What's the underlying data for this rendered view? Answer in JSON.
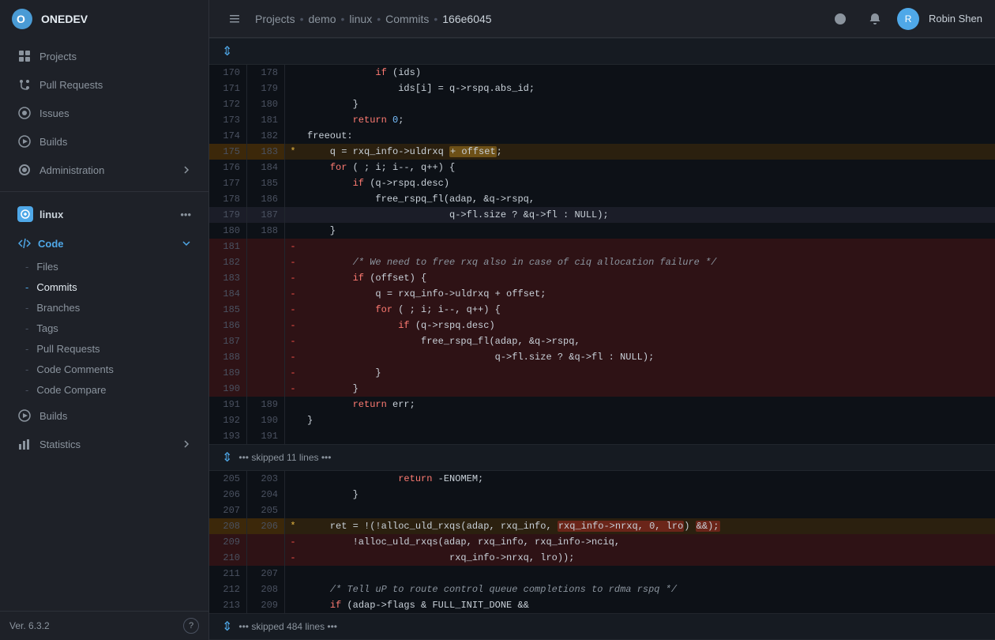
{
  "app": {
    "name": "ONEDEV",
    "version": "Ver. 6.3.2"
  },
  "topnav": {
    "breadcrumb": [
      "Projects",
      "demo",
      "linux",
      "Commits",
      "166e6045"
    ],
    "user": "Robin Shen"
  },
  "sidebar": {
    "top_items": [
      {
        "id": "projects",
        "label": "Projects",
        "icon": "grid-icon"
      },
      {
        "id": "pull-requests",
        "label": "Pull Requests",
        "icon": "pr-icon"
      },
      {
        "id": "issues",
        "label": "Issues",
        "icon": "issue-icon"
      },
      {
        "id": "builds",
        "label": "Builds",
        "icon": "builds-icon"
      },
      {
        "id": "administration",
        "label": "Administration",
        "icon": "admin-icon"
      }
    ],
    "project": {
      "name": "linux",
      "code_label": "Code",
      "sub_items": [
        {
          "id": "files",
          "label": "Files"
        },
        {
          "id": "commits",
          "label": "Commits",
          "active": true
        },
        {
          "id": "branches",
          "label": "Branches"
        },
        {
          "id": "tags",
          "label": "Tags"
        },
        {
          "id": "pull-requests",
          "label": "Pull Requests"
        },
        {
          "id": "code-comments",
          "label": "Code Comments"
        },
        {
          "id": "code-compare",
          "label": "Code Compare"
        }
      ],
      "bottom_items": [
        {
          "id": "builds",
          "label": "Builds"
        },
        {
          "id": "statistics",
          "label": "Statistics"
        }
      ]
    },
    "footer": {
      "version": "Ver. 6.3.2",
      "help": "?"
    }
  },
  "diff": {
    "lines": [
      {
        "old": "170",
        "new": "178",
        "type": "normal",
        "content": "            if (ids)"
      },
      {
        "old": "171",
        "new": "179",
        "type": "normal",
        "content": "                ids[i] = q->rspq.abs_id;"
      },
      {
        "old": "172",
        "new": "180",
        "type": "normal",
        "content": "        }"
      },
      {
        "old": "173",
        "new": "181",
        "type": "normal",
        "content": "        return 0;"
      },
      {
        "old": "174",
        "new": "182",
        "type": "normal",
        "content": "freeout:"
      },
      {
        "old": "175",
        "new": "183",
        "type": "modified",
        "marker": "*",
        "content": "    q = rxq_info->uldrxq + offset;"
      },
      {
        "old": "176",
        "new": "184",
        "type": "normal",
        "content": "    for ( ; i; i--, q++) {"
      },
      {
        "old": "177",
        "new": "185",
        "type": "normal",
        "content": "        if (q->rspq.desc)"
      },
      {
        "old": "178",
        "new": "186",
        "type": "normal",
        "content": "            free_rspq_fl(adap, &q->rspq,"
      },
      {
        "old": "179",
        "new": "187",
        "type": "cursor",
        "content": "                         q->fl.size ? &q->fl : NULL);"
      },
      {
        "old": "180",
        "new": "188",
        "type": "normal",
        "content": "    }"
      },
      {
        "old": "181",
        "new": "",
        "type": "removed",
        "content": "    -"
      },
      {
        "old": "182",
        "new": "",
        "type": "removed",
        "content": "    -        /* We need to free rxq also in case of ciq allocation failure */"
      },
      {
        "old": "183",
        "new": "",
        "type": "removed",
        "content": "    -        if (offset) {"
      },
      {
        "old": "184",
        "new": "",
        "type": "removed",
        "content": "    -            q = rxq_info->uldrxq + offset;"
      },
      {
        "old": "185",
        "new": "",
        "type": "removed",
        "content": "    -            for ( ; i; i--, q++) {"
      },
      {
        "old": "186",
        "new": "",
        "type": "removed",
        "content": "    -                if (q->rspq.desc)"
      },
      {
        "old": "187",
        "new": "",
        "type": "removed",
        "content": "    -                    free_rspq_fl(adap, &q->rspq,"
      },
      {
        "old": "188",
        "new": "",
        "type": "removed",
        "content": "    -                                 q->fl.size ? &q->fl : NULL);"
      },
      {
        "old": "189",
        "new": "",
        "type": "removed",
        "content": "    -            }"
      },
      {
        "old": "190",
        "new": "",
        "type": "removed",
        "content": "    -        }"
      },
      {
        "old": "191",
        "new": "189",
        "type": "normal",
        "content": "        return err;"
      },
      {
        "old": "192",
        "new": "190",
        "type": "normal",
        "content": "}"
      },
      {
        "old": "193",
        "new": "191",
        "type": "normal",
        "content": ""
      },
      {
        "old": "",
        "new": "",
        "type": "skipped",
        "content": "••• skipped 11 lines •••"
      },
      {
        "old": "205",
        "new": "203",
        "type": "normal",
        "content": "                return -ENOMEM;"
      },
      {
        "old": "206",
        "new": "204",
        "type": "normal",
        "content": "        }"
      },
      {
        "old": "207",
        "new": "205",
        "type": "normal",
        "content": ""
      },
      {
        "old": "208",
        "new": "206",
        "type": "modified",
        "marker": "*",
        "content": "    ret = !(!alloc_uld_rxqs(adap, rxq_info, rxq_info->nrxq, 0, lro) &&);"
      },
      {
        "old": "209",
        "new": "",
        "type": "removed2",
        "content": "    -        !alloc_uld_rxqs(adap, rxq_info, rxq_info->nciq,"
      },
      {
        "old": "210",
        "new": "",
        "type": "removed2",
        "content": "    -                         rxq_info->nrxq, lro));"
      },
      {
        "old": "211",
        "new": "207",
        "type": "normal",
        "content": ""
      },
      {
        "old": "212",
        "new": "208",
        "type": "normal",
        "content": "    /* Tell uP to route control queue completions to rdma rspq */"
      },
      {
        "old": "213",
        "new": "209",
        "type": "normal",
        "content": "    if (adap->flags & FULL_INIT_DONE &&"
      },
      {
        "old": "",
        "new": "",
        "type": "skipped2",
        "content": "••• skipped 484 lines •••"
      }
    ]
  }
}
